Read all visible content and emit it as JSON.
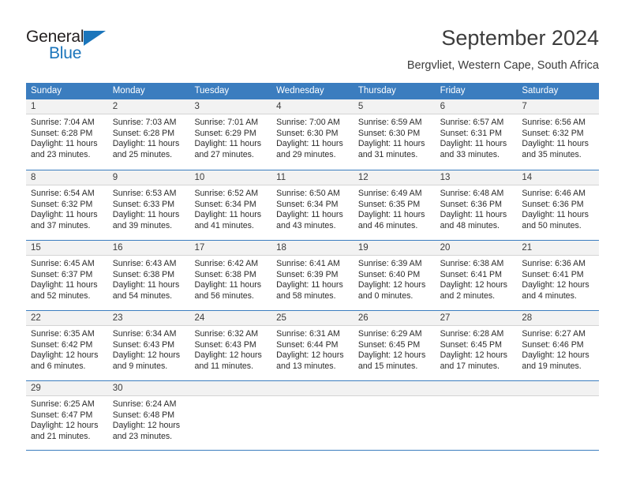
{
  "brand": {
    "name_top": "General",
    "name_bottom": "Blue",
    "accent_color": "#1b75bb"
  },
  "header": {
    "title": "September 2024",
    "subtitle": "Bergvliet, Western Cape, South Africa"
  },
  "calendar": {
    "header_bg": "#3b7dbf",
    "day_band_bg": "#f2f2f2",
    "weekdays": [
      "Sunday",
      "Monday",
      "Tuesday",
      "Wednesday",
      "Thursday",
      "Friday",
      "Saturday"
    ],
    "weeks": [
      [
        {
          "day": "1",
          "sunrise": "Sunrise: 7:04 AM",
          "sunset": "Sunset: 6:28 PM",
          "daylight1": "Daylight: 11 hours",
          "daylight2": "and 23 minutes."
        },
        {
          "day": "2",
          "sunrise": "Sunrise: 7:03 AM",
          "sunset": "Sunset: 6:28 PM",
          "daylight1": "Daylight: 11 hours",
          "daylight2": "and 25 minutes."
        },
        {
          "day": "3",
          "sunrise": "Sunrise: 7:01 AM",
          "sunset": "Sunset: 6:29 PM",
          "daylight1": "Daylight: 11 hours",
          "daylight2": "and 27 minutes."
        },
        {
          "day": "4",
          "sunrise": "Sunrise: 7:00 AM",
          "sunset": "Sunset: 6:30 PM",
          "daylight1": "Daylight: 11 hours",
          "daylight2": "and 29 minutes."
        },
        {
          "day": "5",
          "sunrise": "Sunrise: 6:59 AM",
          "sunset": "Sunset: 6:30 PM",
          "daylight1": "Daylight: 11 hours",
          "daylight2": "and 31 minutes."
        },
        {
          "day": "6",
          "sunrise": "Sunrise: 6:57 AM",
          "sunset": "Sunset: 6:31 PM",
          "daylight1": "Daylight: 11 hours",
          "daylight2": "and 33 minutes."
        },
        {
          "day": "7",
          "sunrise": "Sunrise: 6:56 AM",
          "sunset": "Sunset: 6:32 PM",
          "daylight1": "Daylight: 11 hours",
          "daylight2": "and 35 minutes."
        }
      ],
      [
        {
          "day": "8",
          "sunrise": "Sunrise: 6:54 AM",
          "sunset": "Sunset: 6:32 PM",
          "daylight1": "Daylight: 11 hours",
          "daylight2": "and 37 minutes."
        },
        {
          "day": "9",
          "sunrise": "Sunrise: 6:53 AM",
          "sunset": "Sunset: 6:33 PM",
          "daylight1": "Daylight: 11 hours",
          "daylight2": "and 39 minutes."
        },
        {
          "day": "10",
          "sunrise": "Sunrise: 6:52 AM",
          "sunset": "Sunset: 6:34 PM",
          "daylight1": "Daylight: 11 hours",
          "daylight2": "and 41 minutes."
        },
        {
          "day": "11",
          "sunrise": "Sunrise: 6:50 AM",
          "sunset": "Sunset: 6:34 PM",
          "daylight1": "Daylight: 11 hours",
          "daylight2": "and 43 minutes."
        },
        {
          "day": "12",
          "sunrise": "Sunrise: 6:49 AM",
          "sunset": "Sunset: 6:35 PM",
          "daylight1": "Daylight: 11 hours",
          "daylight2": "and 46 minutes."
        },
        {
          "day": "13",
          "sunrise": "Sunrise: 6:48 AM",
          "sunset": "Sunset: 6:36 PM",
          "daylight1": "Daylight: 11 hours",
          "daylight2": "and 48 minutes."
        },
        {
          "day": "14",
          "sunrise": "Sunrise: 6:46 AM",
          "sunset": "Sunset: 6:36 PM",
          "daylight1": "Daylight: 11 hours",
          "daylight2": "and 50 minutes."
        }
      ],
      [
        {
          "day": "15",
          "sunrise": "Sunrise: 6:45 AM",
          "sunset": "Sunset: 6:37 PM",
          "daylight1": "Daylight: 11 hours",
          "daylight2": "and 52 minutes."
        },
        {
          "day": "16",
          "sunrise": "Sunrise: 6:43 AM",
          "sunset": "Sunset: 6:38 PM",
          "daylight1": "Daylight: 11 hours",
          "daylight2": "and 54 minutes."
        },
        {
          "day": "17",
          "sunrise": "Sunrise: 6:42 AM",
          "sunset": "Sunset: 6:38 PM",
          "daylight1": "Daylight: 11 hours",
          "daylight2": "and 56 minutes."
        },
        {
          "day": "18",
          "sunrise": "Sunrise: 6:41 AM",
          "sunset": "Sunset: 6:39 PM",
          "daylight1": "Daylight: 11 hours",
          "daylight2": "and 58 minutes."
        },
        {
          "day": "19",
          "sunrise": "Sunrise: 6:39 AM",
          "sunset": "Sunset: 6:40 PM",
          "daylight1": "Daylight: 12 hours",
          "daylight2": "and 0 minutes."
        },
        {
          "day": "20",
          "sunrise": "Sunrise: 6:38 AM",
          "sunset": "Sunset: 6:41 PM",
          "daylight1": "Daylight: 12 hours",
          "daylight2": "and 2 minutes."
        },
        {
          "day": "21",
          "sunrise": "Sunrise: 6:36 AM",
          "sunset": "Sunset: 6:41 PM",
          "daylight1": "Daylight: 12 hours",
          "daylight2": "and 4 minutes."
        }
      ],
      [
        {
          "day": "22",
          "sunrise": "Sunrise: 6:35 AM",
          "sunset": "Sunset: 6:42 PM",
          "daylight1": "Daylight: 12 hours",
          "daylight2": "and 6 minutes."
        },
        {
          "day": "23",
          "sunrise": "Sunrise: 6:34 AM",
          "sunset": "Sunset: 6:43 PM",
          "daylight1": "Daylight: 12 hours",
          "daylight2": "and 9 minutes."
        },
        {
          "day": "24",
          "sunrise": "Sunrise: 6:32 AM",
          "sunset": "Sunset: 6:43 PM",
          "daylight1": "Daylight: 12 hours",
          "daylight2": "and 11 minutes."
        },
        {
          "day": "25",
          "sunrise": "Sunrise: 6:31 AM",
          "sunset": "Sunset: 6:44 PM",
          "daylight1": "Daylight: 12 hours",
          "daylight2": "and 13 minutes."
        },
        {
          "day": "26",
          "sunrise": "Sunrise: 6:29 AM",
          "sunset": "Sunset: 6:45 PM",
          "daylight1": "Daylight: 12 hours",
          "daylight2": "and 15 minutes."
        },
        {
          "day": "27",
          "sunrise": "Sunrise: 6:28 AM",
          "sunset": "Sunset: 6:45 PM",
          "daylight1": "Daylight: 12 hours",
          "daylight2": "and 17 minutes."
        },
        {
          "day": "28",
          "sunrise": "Sunrise: 6:27 AM",
          "sunset": "Sunset: 6:46 PM",
          "daylight1": "Daylight: 12 hours",
          "daylight2": "and 19 minutes."
        }
      ],
      [
        {
          "day": "29",
          "sunrise": "Sunrise: 6:25 AM",
          "sunset": "Sunset: 6:47 PM",
          "daylight1": "Daylight: 12 hours",
          "daylight2": "and 21 minutes."
        },
        {
          "day": "30",
          "sunrise": "Sunrise: 6:24 AM",
          "sunset": "Sunset: 6:48 PM",
          "daylight1": "Daylight: 12 hours",
          "daylight2": "and 23 minutes."
        },
        {
          "day": "",
          "sunrise": "",
          "sunset": "",
          "daylight1": "",
          "daylight2": ""
        },
        {
          "day": "",
          "sunrise": "",
          "sunset": "",
          "daylight1": "",
          "daylight2": ""
        },
        {
          "day": "",
          "sunrise": "",
          "sunset": "",
          "daylight1": "",
          "daylight2": ""
        },
        {
          "day": "",
          "sunrise": "",
          "sunset": "",
          "daylight1": "",
          "daylight2": ""
        },
        {
          "day": "",
          "sunrise": "",
          "sunset": "",
          "daylight1": "",
          "daylight2": ""
        }
      ]
    ]
  }
}
